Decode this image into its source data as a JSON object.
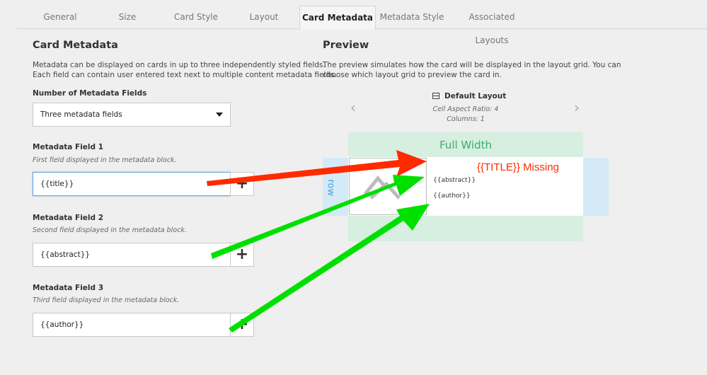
{
  "tabs": [
    {
      "label": "General"
    },
    {
      "label": "Size"
    },
    {
      "label": "Card Style"
    },
    {
      "label": "Layout"
    },
    {
      "label": "Card Metadata",
      "active": true
    },
    {
      "label": "Metadata Style"
    },
    {
      "label": "Associated Layouts"
    }
  ],
  "left": {
    "title": "Card Metadata",
    "desc1": "Metadata can be displayed on cards in up to three independently styled fields.",
    "desc2": "Each field can contain user entered text next to multiple content metadata fields.",
    "num_label": "Number of Metadata Fields",
    "num_value": "Three metadata fields",
    "fields": [
      {
        "label": "Metadata Field 1",
        "hint": "First field displayed in the metadata block.",
        "value": "{{title}}"
      },
      {
        "label": "Metadata Field 2",
        "hint": "Second field displayed in the metadata block.",
        "value": "{{abstract}}"
      },
      {
        "label": "Metadata Field 3",
        "hint": "Third field displayed in the metadata block.",
        "value": "{{author}}"
      }
    ],
    "plus": "+"
  },
  "preview": {
    "title": "Preview",
    "desc1": "The preview simulates how the card will be displayed in the layout grid. You can",
    "desc2": "choose which layout grid to preview the card in.",
    "layout_name": "Default Layout",
    "aspect": "Cell Aspect Ratio: 4",
    "columns": "Columns: 1",
    "prev": "‹",
    "next": "›",
    "full_width": "Full Width",
    "row": "row",
    "card_abstract": "{{abstract}}",
    "card_author": "{{author}}"
  },
  "annotation": {
    "text": "{{TITLE}} Missing",
    "red": "#ff2a00",
    "green": "#00e000"
  },
  "colors": {
    "full_width_bg": "#d6efe0",
    "row_bg": "#d4eaf7",
    "full_width_text": "#3dae6a",
    "row_text": "#4aa3df"
  }
}
